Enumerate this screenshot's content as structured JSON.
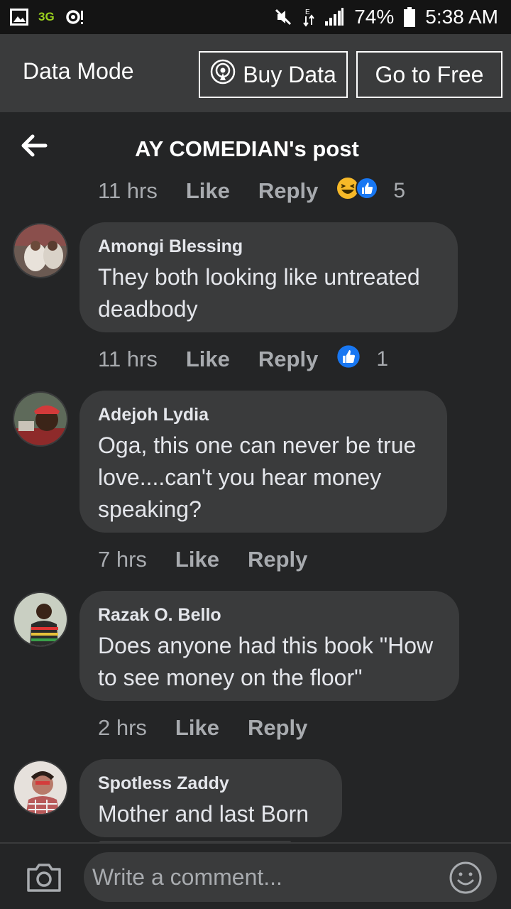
{
  "status_bar": {
    "network": "3G",
    "battery": "74%",
    "time": "5:38 AM"
  },
  "data_mode": {
    "title": "Data Mode",
    "buy_label": "Buy Data",
    "free_label": "Go to Free"
  },
  "post": {
    "title": "AY COMEDIAN's post"
  },
  "comments": [
    {
      "time": "11 hrs",
      "like": "Like",
      "reply": "Reply",
      "reaction_count": "5",
      "reactions": [
        "haha",
        "like"
      ]
    },
    {
      "author": "Amongi Blessing",
      "text": "They both looking like untreated deadbody",
      "time": "11 hrs",
      "like": "Like",
      "reply": "Reply",
      "reaction_count": "1",
      "reactions": [
        "like"
      ]
    },
    {
      "author": "Adejoh Lydia",
      "text": "Oga, this one can never be true love....can't you hear money speaking?",
      "time": "7 hrs",
      "like": "Like",
      "reply": "Reply"
    },
    {
      "author": "Razak O. Bello",
      "text": "Does anyone had this book \"How to see money on the floor\"",
      "time": "2 hrs",
      "like": "Like",
      "reply": "Reply"
    },
    {
      "author": "Spotless Zaddy",
      "text": "Mother and last Born"
    }
  ],
  "composer": {
    "placeholder": "Write a comment..."
  },
  "colors": {
    "background": "#242526",
    "bubble": "#3a3b3c",
    "status_bar": "#141414",
    "like_blue": "#1877f2",
    "haha_yellow": "#f7b928"
  }
}
